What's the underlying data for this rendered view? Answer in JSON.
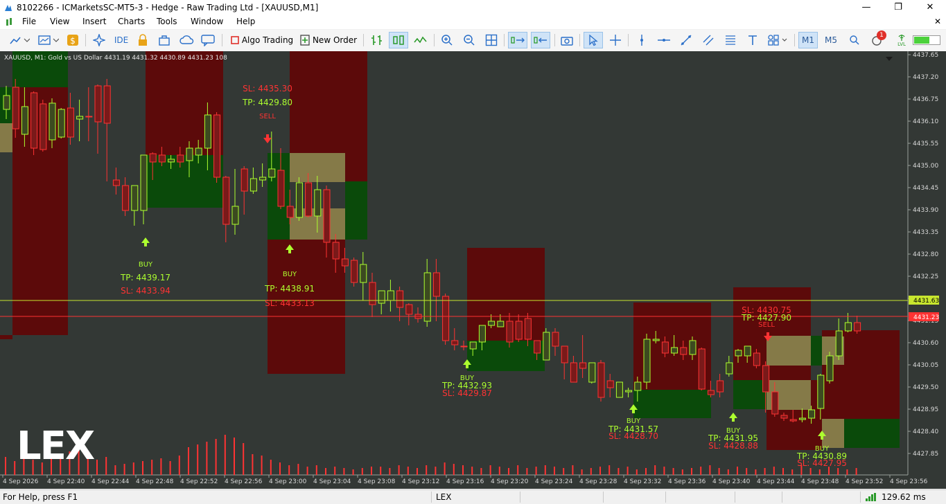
{
  "window": {
    "title": "8102266 - ICMarketsSC-MT5-3 - Hedge - Raw Trading Ltd - [XAUUSD,M1]",
    "minimize": "—",
    "restore": "❐",
    "close": "✕"
  },
  "menu": [
    "File",
    "View",
    "Insert",
    "Charts",
    "Tools",
    "Window",
    "Help"
  ],
  "toolbar": {
    "ide_label": "IDE",
    "algo_label": "Algo Trading",
    "new_order_label": "New Order",
    "tf_m1": "M1",
    "tf_m5": "M5",
    "notify_count": "1",
    "ping_label": "LVL"
  },
  "chart": {
    "symbol_line": "XAUUSD, M1:  Gold vs US Dollar  4431.19 4431.32 4430.89 4431.23  108",
    "watermark": "LEX",
    "price_ticks": [
      "4437.65",
      "4437.20",
      "4436.75",
      "4436.10",
      "4435.55",
      "4435.00",
      "4434.45",
      "4433.90",
      "4433.35",
      "4432.80",
      "4432.25",
      "4431.70",
      "4431.15",
      "4430.60",
      "4430.05",
      "4429.50",
      "4428.95",
      "4428.40",
      "4427.85"
    ],
    "time_ticks": [
      "4 Sep 2026",
      "4 Sep 22:40",
      "4 Sep 22:44",
      "4 Sep 22:48",
      "4 Sep 22:52",
      "4 Sep 22:56",
      "4 Sep 23:00",
      "4 Sep 23:04",
      "4 Sep 23:08",
      "4 Sep 23:12",
      "4 Sep 23:16",
      "4 Sep 23:20",
      "4 Sep 23:24",
      "4 Sep 23:28",
      "4 Sep 23:32",
      "4 Sep 23:36",
      "4 Sep 23:40",
      "4 Sep 23:44",
      "4 Sep 23:48",
      "4 Sep 23:52",
      "4 Sep 23:56"
    ],
    "ask_price": "4431.63",
    "bid_price": "4431.23",
    "colors": {
      "background": "#333835",
      "bull": "#adff2f",
      "bear": "#ff3333",
      "ask_line": "#c8e62e",
      "bid_line": "#ff3333",
      "red_zone": "#5c0a0a",
      "green_zone": "#0a4a0a",
      "khaki_zone": "#857a48"
    },
    "signals": [
      {
        "type": "BUY",
        "label": "BUY",
        "tp": "TP: 4439.17",
        "sl": "SL: 4433.94"
      },
      {
        "type": "SELL",
        "label": "SELL",
        "tp": "TP: 4429.80",
        "sl": "SL: 4435.30"
      },
      {
        "type": "BUY",
        "label": "BUY",
        "tp": "TP: 4438.91",
        "sl": "SL: 4433.13"
      },
      {
        "type": "BUY",
        "label": "BUY",
        "tp": "TP: 4432.93",
        "sl": "SL: 4429.87"
      },
      {
        "type": "BUY",
        "label": "BUY",
        "tp": "TP: 4431.57",
        "sl": "SL: 4428.70"
      },
      {
        "type": "BUY",
        "label": "BUY",
        "tp": "TP: 4431.95",
        "sl": "SL: 4428.88"
      },
      {
        "type": "SELL",
        "label": "SELL",
        "tp": "TP: 4427.90",
        "sl": "SL: 4430.75"
      },
      {
        "type": "BUY",
        "label": "BUY",
        "tp": "TP: 4430.89",
        "sl": "SL: 4427.95"
      }
    ]
  },
  "status": {
    "help": "For Help, press F1",
    "profile": "LEX",
    "ping": "129.62 ms"
  }
}
